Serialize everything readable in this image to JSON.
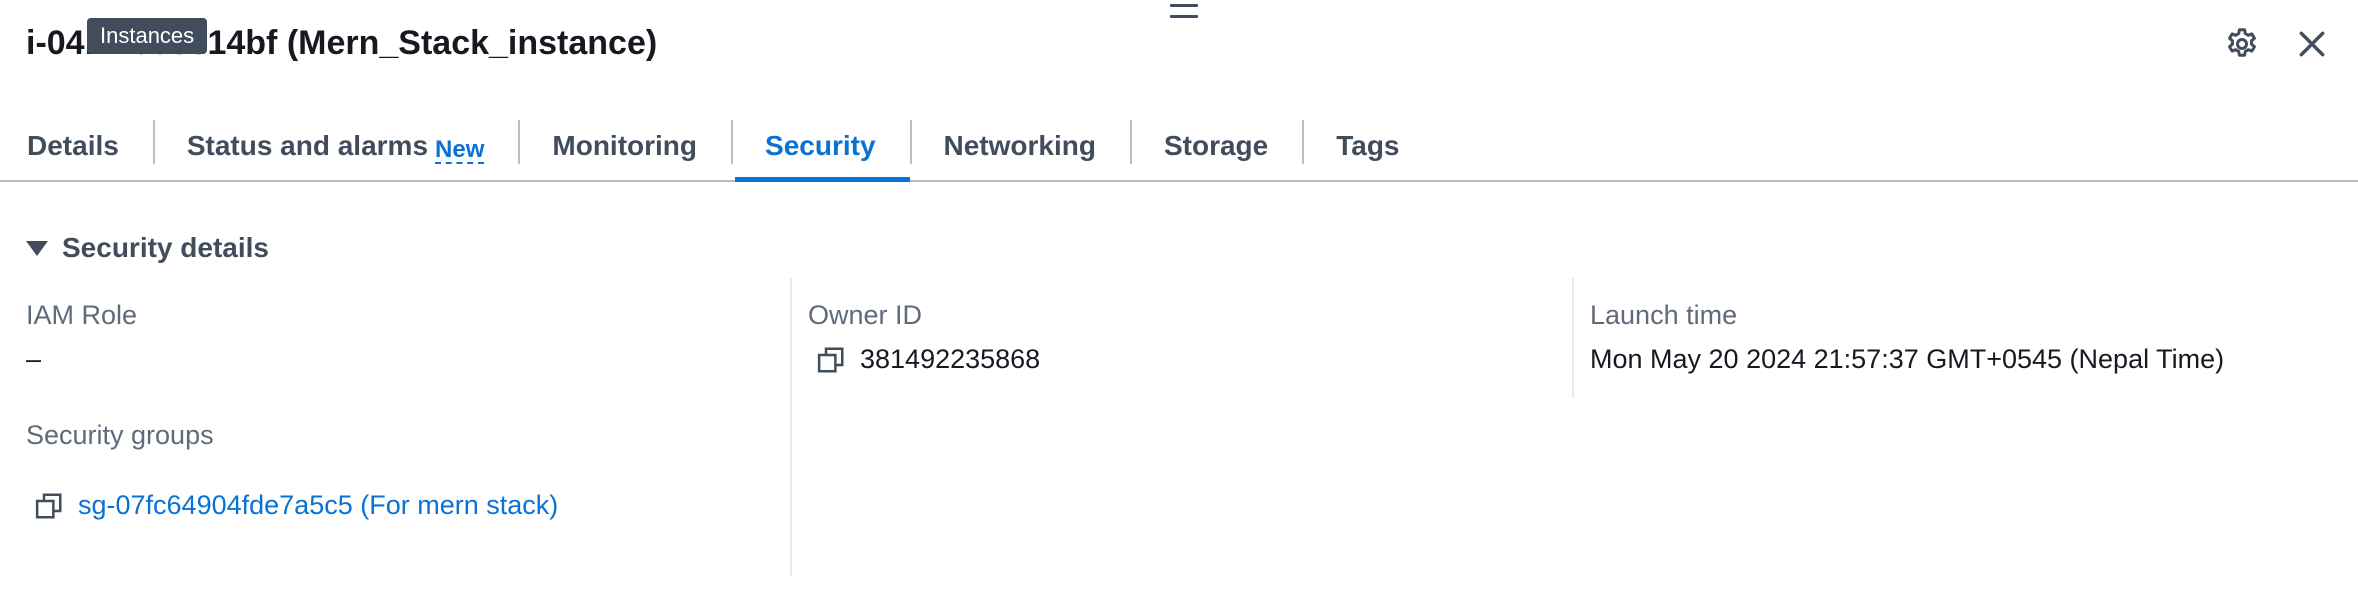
{
  "header": {
    "title": "i-04...70e3314bf (Mern_Stack_instance)",
    "tooltip": "Instances",
    "icons": [
      "drag-handle-icon",
      "settings-gear-icon",
      "close-icon"
    ]
  },
  "tabs": [
    {
      "label": "Details"
    },
    {
      "label": "Status and alarms",
      "badge": "New"
    },
    {
      "label": "Monitoring"
    },
    {
      "label": "Security",
      "active": true
    },
    {
      "label": "Networking"
    },
    {
      "label": "Storage"
    },
    {
      "label": "Tags"
    }
  ],
  "security_details": {
    "section_title": "Security details",
    "iam_role": {
      "label": "IAM Role",
      "value": "–"
    },
    "owner_id": {
      "label": "Owner ID",
      "value": "381492235868"
    },
    "launch_time": {
      "label": "Launch time",
      "value": "Mon May 20 2024 21:57:37 GMT+0545 (Nepal Time)"
    },
    "security_groups": {
      "label": "Security groups",
      "value": "sg-07fc64904fde7a5c5 (For mern stack)"
    }
  },
  "colors": {
    "accent": "#0972d3",
    "text": "#16191f",
    "muted": "#5f6b7a",
    "tab_text": "#414d5c",
    "divider": "#b6bec9"
  }
}
